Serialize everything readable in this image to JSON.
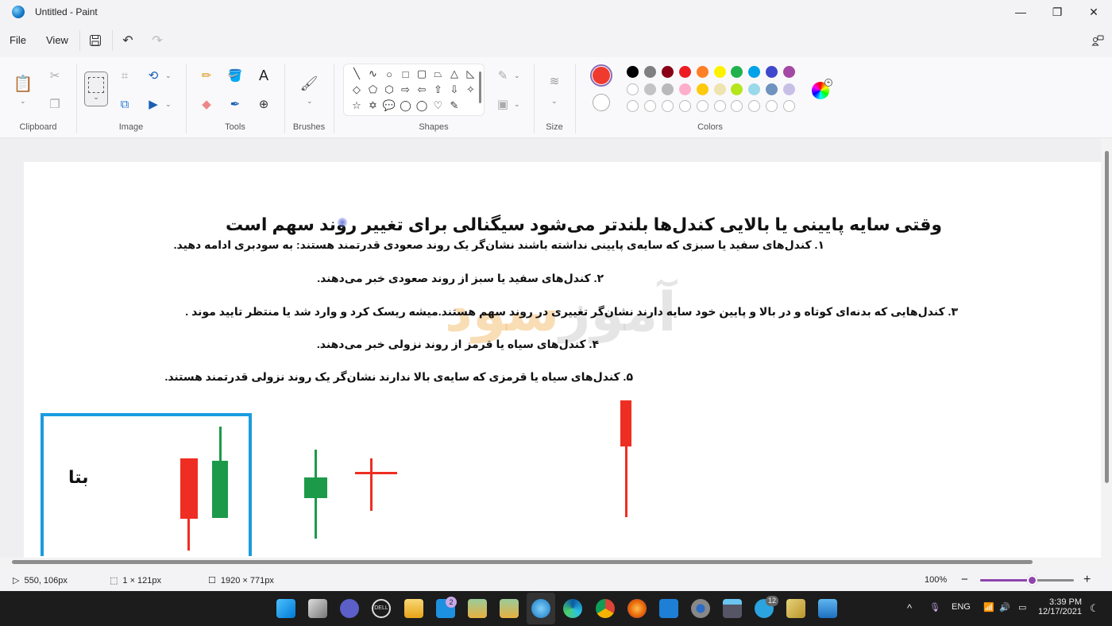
{
  "window": {
    "title": "Untitled - Paint",
    "minimize": "—",
    "restore": "❐",
    "close": "✕"
  },
  "menu": {
    "file": "File",
    "view": "View",
    "save_icon": "💾",
    "undo_icon": "↶",
    "redo_icon": "↷",
    "share_icon": "⎘"
  },
  "ribbon": {
    "groups": {
      "clipboard": "Clipboard",
      "image": "Image",
      "tools": "Tools",
      "brushes": "Brushes",
      "shapes": "Shapes",
      "size": "Size",
      "colors": "Colors"
    },
    "shapes": [
      "╲",
      "∿",
      "○",
      "□",
      "▢",
      "⏢",
      "△",
      "◺",
      "◇",
      "⬠",
      "⬡",
      "⇨",
      "⇦",
      "⇧",
      "⇩",
      "✧",
      "☆",
      "✡",
      "💬",
      "◯",
      "◯",
      "♡",
      "✎"
    ],
    "primary_color": "#f03a2e",
    "secondary_color": "#ffffff",
    "palette_row1": [
      "#000000",
      "#7f7f7f",
      "#880015",
      "#ed1c24",
      "#ff7f27",
      "#fff200",
      "#22b14c",
      "#00a2e8",
      "#3f48cc",
      "#a349a4"
    ],
    "palette_row2": [
      "#ffffff",
      "#c3c3c3",
      "#b9b9b9",
      "#ffaec9",
      "#ffc90e",
      "#efe4b0",
      "#b5e61d",
      "#99d9ea",
      "#7092be",
      "#c8bfe7"
    ]
  },
  "document": {
    "heading": "وقتی سایه پایینی یا بالایی کندل‌ها بلندتر می‌شود  سیگنالی برای تغییر روند سهم است",
    "lines": [
      "۱. کندل‌های سفید یا سبزی که سایه‌ی پایینی نداشته باشند نشان‌گر یک روند صعودی قدرتمند هستند: به سودبری ادامه دهید.",
      "۲. کندل‌های سفید یا سبز از روند صعودی خبر می‌دهند.",
      "۳. کندل‌هایی که بدنه‌ای کوتاه و در بالا و پایین خود سایه دارند نشان‌گر تغییری در روند سهم هستند.میشه ریسک کرد و وارد شد یا منتظر تایید موند .",
      "۴. کندل‌های سیاه یا قرمز از روند نزولی خبر می‌دهند.",
      "۵. کندل‌های سیاه یا قرمزی که سایه‌ی بالا ندارند نشان‌گر یک روند نزولی قدرتمند هستند."
    ],
    "box_label": "بتا",
    "watermark_a": "سود",
    "watermark_b": "آموز"
  },
  "status": {
    "cursor": "550, 106px",
    "selection": "1 × 121px",
    "canvas_size": "1920 × 771px",
    "zoom": "100%",
    "zoom_level": 0.55
  },
  "taskbar": {
    "mail_badge": "2",
    "telegram_badge": "12",
    "lang": "ENG",
    "time": "3:39 PM",
    "date": "12/17/2021"
  }
}
